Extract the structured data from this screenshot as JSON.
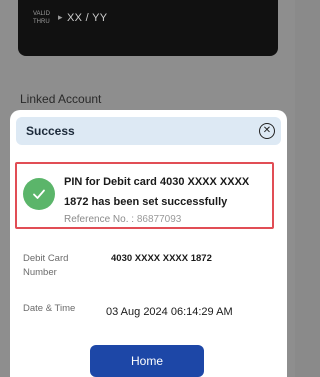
{
  "background": {
    "card": {
      "valid_thru_label_1": "VALID",
      "valid_thru_label_2": "THRU",
      "arrow": "▸",
      "valid_value": "XX / YY"
    },
    "linked_account_label": "Linked Account"
  },
  "modal": {
    "title": "Success",
    "close_icon": "close-icon",
    "success": {
      "message_line1": "PIN for Debit card 4030  XXXX XXXX",
      "message_line2": "1872 has been set successfully",
      "reference_label": "Reference No. :",
      "reference_value": "86877093"
    },
    "details": {
      "debit_card_label": "Debit Card Number",
      "debit_card_value": "4030 XXXX XXXX 1872",
      "date_time_label": "Date & Time",
      "date_time_value": "03 Aug 2024 06:14:29 AM"
    },
    "home_button": "Home"
  },
  "colors": {
    "accent": "#1d47a7",
    "success_green": "#5bb56a",
    "highlight_red": "#e14d55",
    "header_bg": "#dde9f4"
  }
}
